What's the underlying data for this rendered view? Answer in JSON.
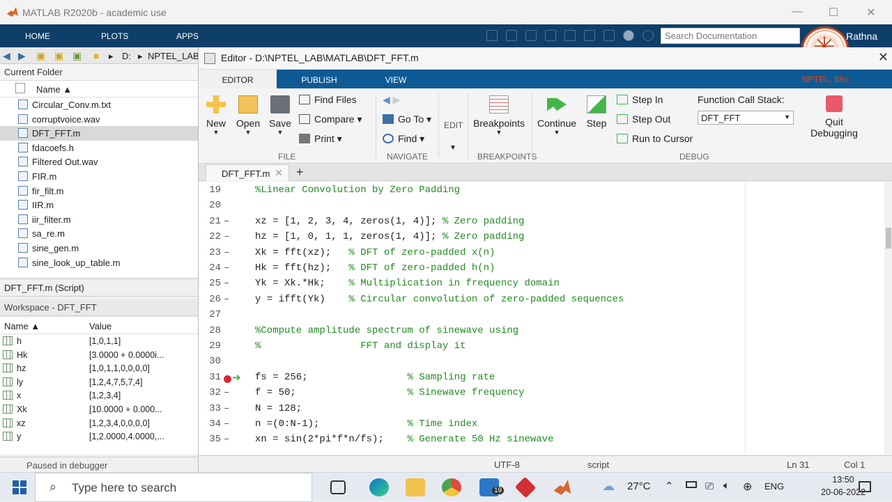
{
  "window": {
    "title": "MATLAB R2020b - academic use"
  },
  "ribbon": {
    "tabs": [
      "HOME",
      "PLOTS",
      "APPS"
    ],
    "search_placeholder": "Search Documentation",
    "user": "Rathna"
  },
  "nav": {
    "drive": "D:",
    "folder": "NPTEL_LAB"
  },
  "current_folder": {
    "title": "Current Folder",
    "col_name": "Name ▲",
    "files": [
      "Circular_Conv.m.txt",
      "corruptvoice.wav",
      "DFT_FFT.m",
      "fdacoefs.h",
      "Filtered Out.wav",
      "FIR.m",
      "fir_filt.m",
      "IIR.m",
      "iir_filter.m",
      "sa_re.m",
      "sine_gen.m",
      "sine_look_up_table.m"
    ],
    "selected_index": 2,
    "details": "DFT_FFT.m  (Script)"
  },
  "workspace": {
    "title": "Workspace - DFT_FFT",
    "col_name": "Name ▲",
    "col_value": "Value",
    "vars": [
      {
        "name": "h",
        "value": "[1,0,1,1]"
      },
      {
        "name": "Hk",
        "value": "[3.0000 + 0.0000i..."
      },
      {
        "name": "hz",
        "value": "[1,0,1,1,0,0,0,0]"
      },
      {
        "name": "ly",
        "value": "[1,2,4,7,5,7,4]"
      },
      {
        "name": "x",
        "value": "[1,2,3,4]"
      },
      {
        "name": "Xk",
        "value": "[10.0000 + 0.000..."
      },
      {
        "name": "xz",
        "value": "[1,2,3,4,0,0,0,0]"
      },
      {
        "name": "y",
        "value": "[1,2.0000,4.0000,..."
      }
    ],
    "status": "Paused in debugger"
  },
  "editor": {
    "title": "Editor - D:\\NPTEL_LAB\\MATLAB\\DFT_FFT.m",
    "tabs": [
      "EDITOR",
      "PUBLISH",
      "VIEW"
    ],
    "doc_tab": "DFT_FFT.m",
    "brand": "NPTEL, IISc"
  },
  "toolstrip": {
    "new": "New",
    "open": "Open",
    "save": "Save",
    "find_files": "Find Files",
    "compare": "Compare",
    "print": "Print",
    "go_to": "Go To",
    "find": "Find",
    "edit": "EDIT",
    "breakpoints": "Breakpoints",
    "continue": "Continue",
    "step": "Step",
    "step_in": "Step In",
    "step_out": "Step Out",
    "run_to_cursor": "Run to Cursor",
    "fcs_label": "Function Call Stack:",
    "fcs_value": "DFT_FFT",
    "quit": "Quit",
    "debugging": "Debugging",
    "groups": {
      "file": "FILE",
      "navigate": "NAVIGATE",
      "breakpoints": "BREAKPOINTS",
      "debug": "DEBUG"
    }
  },
  "code": [
    {
      "n": "19",
      "dash": false,
      "t": "%Linear Convolution by Zero Padding",
      "c": ""
    },
    {
      "n": "20",
      "dash": false,
      "t": "",
      "c": ""
    },
    {
      "n": "21",
      "dash": true,
      "t": "xz = [1, 2, 3, 4, zeros(1, 4)]; ",
      "c": "% Zero padding"
    },
    {
      "n": "22",
      "dash": true,
      "t": "hz = [1, 0, 1, 1, zeros(1, 4)]; ",
      "c": "% Zero padding"
    },
    {
      "n": "23",
      "dash": true,
      "t": "Xk = fft(xz);   ",
      "c": "% DFT of zero-padded x(n)"
    },
    {
      "n": "24",
      "dash": true,
      "t": "Hk = fft(hz);   ",
      "c": "% DFT of zero-padded h(n)"
    },
    {
      "n": "25",
      "dash": true,
      "t": "Yk = Xk.*Hk;    ",
      "c": "% Multiplication in frequency domain"
    },
    {
      "n": "26",
      "dash": true,
      "t": "y = ifft(Yk)    ",
      "c": "% Circular convolution of zero-padded sequences"
    },
    {
      "n": "27",
      "dash": false,
      "t": "",
      "c": ""
    },
    {
      "n": "28",
      "dash": false,
      "t": "",
      "c": "%Compute amplitude spectrum of sinewave using"
    },
    {
      "n": "29",
      "dash": false,
      "t": "",
      "c": "%                 FFT and display it"
    },
    {
      "n": "30",
      "dash": false,
      "t": "",
      "c": ""
    },
    {
      "n": "31",
      "dash": false,
      "t": "fs = 256;                 ",
      "c": "% Sampling rate"
    },
    {
      "n": "32",
      "dash": true,
      "t": "f = 50;                   ",
      "c": "% Sinewave frequency"
    },
    {
      "n": "33",
      "dash": true,
      "t": "N = 128;",
      "c": ""
    },
    {
      "n": "34",
      "dash": true,
      "t": "n =(0:N-1);               ",
      "c": "% Time index"
    },
    {
      "n": "35",
      "dash": true,
      "t": "xn = sin(2*pi*f*n/fs);    ",
      "c": "% Generate 50 Hz sinewave"
    }
  ],
  "status": {
    "encoding": "UTF-8",
    "type": "script",
    "ln": "Ln  31",
    "col": "Col  1"
  },
  "taskbar": {
    "search_placeholder": "Type here to search",
    "temp": "27°C",
    "lang": "ENG",
    "time": "13:50",
    "date": "20-06-2022",
    "mail_badge": "19"
  }
}
